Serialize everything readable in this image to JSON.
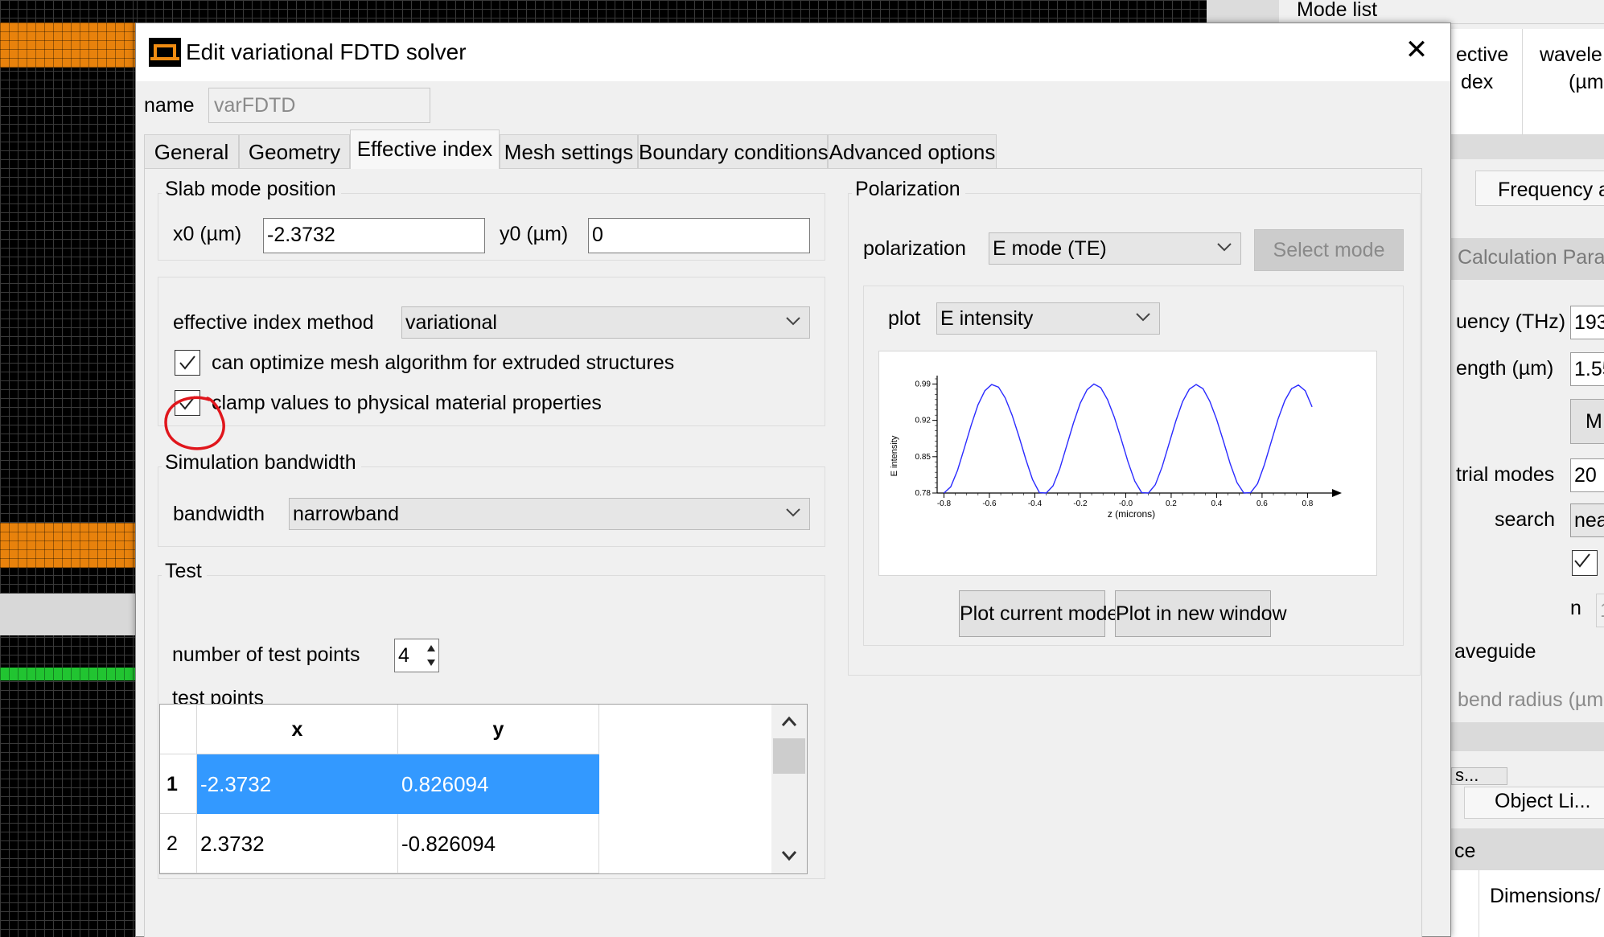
{
  "dialog": {
    "title": "Edit variational FDTD solver",
    "close_glyph": "✕",
    "name_label": "name",
    "name_value": "varFDTD"
  },
  "tabs": [
    {
      "label": "General"
    },
    {
      "label": "Geometry"
    },
    {
      "label": "Effective index",
      "active": true
    },
    {
      "label": "Mesh settings"
    },
    {
      "label": "Boundary conditions"
    },
    {
      "label": "Advanced options"
    }
  ],
  "slab": {
    "title": "Slab mode position",
    "x0_label": "x0 (µm)",
    "x0_value": "-2.3732",
    "y0_label": "y0 (µm)",
    "y0_value": "0"
  },
  "eff_index": {
    "method_label": "effective index method",
    "method_value": "variational",
    "optimize_mesh_label": "can optimize mesh algorithm for extruded structures",
    "optimize_mesh_checked": true,
    "clamp_label": "clamp values to physical material properties",
    "clamp_checked": true
  },
  "bandwidth": {
    "title": "Simulation bandwidth",
    "label": "bandwidth",
    "value": "narrowband"
  },
  "test": {
    "title": "Test",
    "num_points_label": "number of test points",
    "num_points_value": "4",
    "points_label": "test points",
    "columns": [
      "x",
      "y"
    ],
    "rows": [
      {
        "index": "1",
        "x": "-2.3732",
        "y": "0.826094",
        "selected": true
      },
      {
        "index": "2",
        "x": "2.3732",
        "y": "-0.826094",
        "selected": false
      }
    ]
  },
  "polarization": {
    "title": "Polarization",
    "label": "polarization",
    "value": "E mode (TE)",
    "select_mode_label": "Select mode",
    "plot_label": "plot",
    "plot_value": "E intensity",
    "plot_current_label": "Plot current mode",
    "plot_new_window_label": "Plot in new window"
  },
  "chart_data": {
    "type": "line",
    "xlabel": "z (microns)",
    "ylabel": "E intensity",
    "xlim": [
      -0.83,
      0.88
    ],
    "ylim": [
      0.78,
      1.0
    ],
    "xticks": [
      -0.8,
      -0.6,
      -0.4,
      -0.2,
      0.0,
      0.2,
      0.4,
      0.6,
      0.8
    ],
    "xtick_labels": [
      "-0.8",
      "-0.6",
      "-0.4",
      "-0.2",
      "-0.0",
      "0.2",
      "0.4",
      "0.6",
      "0.8"
    ],
    "yticks": [
      0.78,
      0.85,
      0.92,
      0.99
    ],
    "ytick_labels": [
      "0.78",
      "0.85",
      "0.92",
      "0.99"
    ],
    "series": [
      {
        "color": "#2b2bff",
        "x": [
          -0.8,
          -0.77,
          -0.74,
          -0.71,
          -0.68,
          -0.65,
          -0.62,
          -0.59,
          -0.56,
          -0.53,
          -0.5,
          -0.47,
          -0.44,
          -0.41,
          -0.38,
          -0.35,
          -0.32,
          -0.29,
          -0.26,
          -0.23,
          -0.2,
          -0.17,
          -0.14,
          -0.11,
          -0.08,
          -0.05,
          -0.02,
          0.01,
          0.04,
          0.07,
          0.1,
          0.13,
          0.16,
          0.19,
          0.22,
          0.25,
          0.28,
          0.31,
          0.34,
          0.37,
          0.4,
          0.43,
          0.46,
          0.49,
          0.52,
          0.55,
          0.58,
          0.61,
          0.64,
          0.67,
          0.7,
          0.73,
          0.76,
          0.79,
          0.82
        ],
        "y": [
          0.78,
          0.792,
          0.824,
          0.867,
          0.911,
          0.95,
          0.977,
          0.989,
          0.984,
          0.963,
          0.93,
          0.889,
          0.845,
          0.806,
          0.781,
          0.78,
          0.794,
          0.827,
          0.871,
          0.915,
          0.953,
          0.979,
          0.99,
          0.983,
          0.96,
          0.926,
          0.884,
          0.84,
          0.803,
          0.781,
          0.78,
          0.796,
          0.83,
          0.874,
          0.918,
          0.956,
          0.98,
          0.989,
          0.981,
          0.957,
          0.922,
          0.88,
          0.836,
          0.8,
          0.78,
          0.781,
          0.798,
          0.834,
          0.878,
          0.922,
          0.958,
          0.981,
          0.988,
          0.977,
          0.946
        ]
      }
    ]
  },
  "background_panel": {
    "mode_list_title": "Mode list",
    "col_effective": "ective",
    "col_index": "dex",
    "col_wavele": "wavele",
    "col_um": "(µm",
    "tab_frequency": "Frequency a",
    "calc_params": "Calculation Para",
    "frequency_label": "uency (THz)",
    "frequency_value": "193",
    "wavelength_label": "ength (µm)",
    "wavelength_value": "1.55",
    "btn_m": "M",
    "trial_modes_label": "trial modes",
    "trial_modes_value": "20",
    "search_label": "search",
    "search_value": "nea",
    "n_label": "n",
    "n_value": "1",
    "waveguide_label": "aveguide",
    "bend_radius_label": "bend radius (µm",
    "btn_s": "s...",
    "object_list_tab": "Object Li...",
    "ce_label": "ce",
    "dimensions_label": "Dimensions/"
  },
  "colors": {
    "mesh_orange": "#e8820c",
    "mesh_green": "#21c431",
    "selection_blue": "#3399ff",
    "annotation_red": "#e0161c"
  }
}
